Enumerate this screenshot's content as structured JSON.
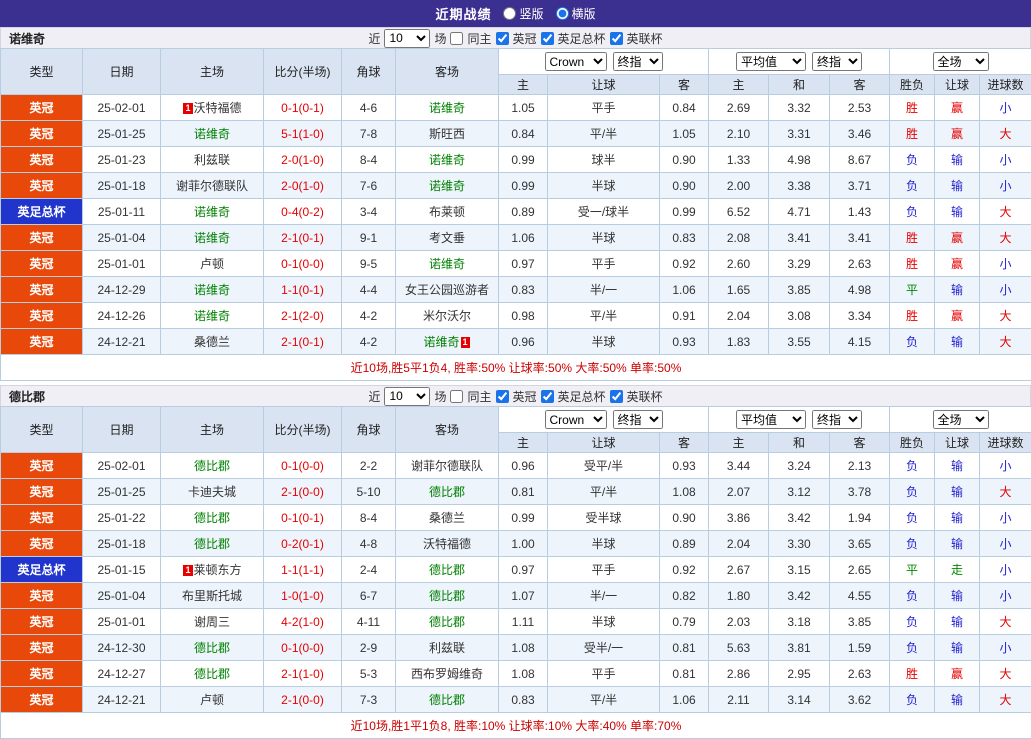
{
  "title_bar": {
    "title": "近期战绩",
    "options": [
      {
        "label": "竖版",
        "selected": false
      },
      {
        "label": "横版",
        "selected": true
      }
    ]
  },
  "colors": {
    "topbar": "#3b2f90",
    "league_championship": "#e8490b",
    "league_fa_cup": "#2135cc",
    "focus_team": "#008000",
    "win": "#e60000",
    "loss": "#2222cc",
    "draw": "#008800",
    "score": "#e60000"
  },
  "sections": [
    {
      "team": "诺维奇",
      "filter": {
        "near_label": "近",
        "count": "10",
        "unit_label": "场",
        "same_home": {
          "label": "同主",
          "checked": false
        },
        "leagues": [
          {
            "label": "英冠",
            "checked": true
          },
          {
            "label": "英足总杯",
            "checked": true
          },
          {
            "label": "英联杯",
            "checked": true
          }
        ]
      },
      "header": {
        "base_cols": [
          "类型",
          "日期",
          "主场",
          "比分(半场)",
          "角球",
          "客场"
        ],
        "bookmaker_select": "Crown",
        "final_select": "终指",
        "average_select": "平均值",
        "final_select2": "终指",
        "scope_select": "全场",
        "sub_cols": [
          "主",
          "让球",
          "客",
          "主",
          "和",
          "客",
          "胜负",
          "让球",
          "进球数"
        ]
      },
      "rows": [
        {
          "type": "英冠",
          "date": "25-02-01",
          "home": {
            "name": "沃特福德",
            "badge": "1",
            "badge_pos": "pre"
          },
          "score": "0-1(0-1)",
          "corner": "4-6",
          "away": {
            "name": "诺维奇",
            "focus": true
          },
          "asia": [
            "1.05",
            "平手",
            "0.84"
          ],
          "euro": [
            "2.69",
            "3.32",
            "2.53"
          ],
          "results": [
            "胜",
            "赢",
            "小"
          ]
        },
        {
          "type": "英冠",
          "date": "25-01-25",
          "home": {
            "name": "诺维奇",
            "focus": true
          },
          "score": "5-1(1-0)",
          "corner": "7-8",
          "away": {
            "name": "斯旺西"
          },
          "asia": [
            "0.84",
            "平/半",
            "1.05"
          ],
          "euro": [
            "2.10",
            "3.31",
            "3.46"
          ],
          "results": [
            "胜",
            "赢",
            "大"
          ]
        },
        {
          "type": "英冠",
          "date": "25-01-23",
          "home": {
            "name": "利兹联"
          },
          "score": "2-0(1-0)",
          "corner": "8-4",
          "away": {
            "name": "诺维奇",
            "focus": true
          },
          "asia": [
            "0.99",
            "球半",
            "0.90"
          ],
          "euro": [
            "1.33",
            "4.98",
            "8.67"
          ],
          "results": [
            "负",
            "输",
            "小"
          ]
        },
        {
          "type": "英冠",
          "date": "25-01-18",
          "home": {
            "name": "谢菲尔德联队"
          },
          "score": "2-0(1-0)",
          "corner": "7-6",
          "away": {
            "name": "诺维奇",
            "focus": true
          },
          "asia": [
            "0.99",
            "半球",
            "0.90"
          ],
          "euro": [
            "2.00",
            "3.38",
            "3.71"
          ],
          "results": [
            "负",
            "输",
            "小"
          ]
        },
        {
          "type": "英足总杯",
          "date": "25-01-11",
          "home": {
            "name": "诺维奇",
            "focus": true
          },
          "score": "0-4(0-2)",
          "corner": "3-4",
          "away": {
            "name": "布莱顿"
          },
          "asia": [
            "0.89",
            "受一/球半",
            "0.99"
          ],
          "euro": [
            "6.52",
            "4.71",
            "1.43"
          ],
          "results": [
            "负",
            "输",
            "大"
          ]
        },
        {
          "type": "英冠",
          "date": "25-01-04",
          "home": {
            "name": "诺维奇",
            "focus": true
          },
          "score": "2-1(0-1)",
          "corner": "9-1",
          "away": {
            "name": "考文垂"
          },
          "asia": [
            "1.06",
            "半球",
            "0.83"
          ],
          "euro": [
            "2.08",
            "3.41",
            "3.41"
          ],
          "results": [
            "胜",
            "赢",
            "大"
          ]
        },
        {
          "type": "英冠",
          "date": "25-01-01",
          "home": {
            "name": "卢顿"
          },
          "score": "0-1(0-0)",
          "corner": "9-5",
          "away": {
            "name": "诺维奇",
            "focus": true
          },
          "asia": [
            "0.97",
            "平手",
            "0.92"
          ],
          "euro": [
            "2.60",
            "3.29",
            "2.63"
          ],
          "results": [
            "胜",
            "赢",
            "小"
          ]
        },
        {
          "type": "英冠",
          "date": "24-12-29",
          "home": {
            "name": "诺维奇",
            "focus": true
          },
          "score": "1-1(0-1)",
          "corner": "4-4",
          "away": {
            "name": "女王公园巡游者"
          },
          "asia": [
            "0.83",
            "半/一",
            "1.06"
          ],
          "euro": [
            "1.65",
            "3.85",
            "4.98"
          ],
          "results": [
            "平",
            "输",
            "小"
          ]
        },
        {
          "type": "英冠",
          "date": "24-12-26",
          "home": {
            "name": "诺维奇",
            "focus": true
          },
          "score": "2-1(2-0)",
          "corner": "4-2",
          "away": {
            "name": "米尔沃尔"
          },
          "asia": [
            "0.98",
            "平/半",
            "0.91"
          ],
          "euro": [
            "2.04",
            "3.08",
            "3.34"
          ],
          "results": [
            "胜",
            "赢",
            "大"
          ]
        },
        {
          "type": "英冠",
          "date": "24-12-21",
          "home": {
            "name": "桑德兰"
          },
          "score": "2-1(0-1)",
          "corner": "4-2",
          "away": {
            "name": "诺维奇",
            "focus": true,
            "badge": "1",
            "badge_pos": "post"
          },
          "asia": [
            "0.96",
            "半球",
            "0.93"
          ],
          "euro": [
            "1.83",
            "3.55",
            "4.15"
          ],
          "results": [
            "负",
            "输",
            "大"
          ]
        }
      ],
      "summary": "近10场,胜5平1负4, 胜率:50% 让球率:50% 大率:50% 单率:50%"
    },
    {
      "team": "德比郡",
      "filter": {
        "near_label": "近",
        "count": "10",
        "unit_label": "场",
        "same_home": {
          "label": "同主",
          "checked": false
        },
        "leagues": [
          {
            "label": "英冠",
            "checked": true
          },
          {
            "label": "英足总杯",
            "checked": true
          },
          {
            "label": "英联杯",
            "checked": true
          }
        ]
      },
      "header": {
        "base_cols": [
          "类型",
          "日期",
          "主场",
          "比分(半场)",
          "角球",
          "客场"
        ],
        "bookmaker_select": "Crown",
        "final_select": "终指",
        "average_select": "平均值",
        "final_select2": "终指",
        "scope_select": "全场",
        "sub_cols": [
          "主",
          "让球",
          "客",
          "主",
          "和",
          "客",
          "胜负",
          "让球",
          "进球数"
        ]
      },
      "rows": [
        {
          "type": "英冠",
          "date": "25-02-01",
          "home": {
            "name": "德比郡",
            "focus": true
          },
          "score": "0-1(0-0)",
          "corner": "2-2",
          "away": {
            "name": "谢菲尔德联队"
          },
          "asia": [
            "0.96",
            "受平/半",
            "0.93"
          ],
          "euro": [
            "3.44",
            "3.24",
            "2.13"
          ],
          "results": [
            "负",
            "输",
            "小"
          ]
        },
        {
          "type": "英冠",
          "date": "25-01-25",
          "home": {
            "name": "卡迪夫城"
          },
          "score": "2-1(0-0)",
          "corner": "5-10",
          "away": {
            "name": "德比郡",
            "focus": true
          },
          "asia": [
            "0.81",
            "平/半",
            "1.08"
          ],
          "euro": [
            "2.07",
            "3.12",
            "3.78"
          ],
          "results": [
            "负",
            "输",
            "大"
          ]
        },
        {
          "type": "英冠",
          "date": "25-01-22",
          "home": {
            "name": "德比郡",
            "focus": true
          },
          "score": "0-1(0-1)",
          "corner": "8-4",
          "away": {
            "name": "桑德兰"
          },
          "asia": [
            "0.99",
            "受半球",
            "0.90"
          ],
          "euro": [
            "3.86",
            "3.42",
            "1.94"
          ],
          "results": [
            "负",
            "输",
            "小"
          ]
        },
        {
          "type": "英冠",
          "date": "25-01-18",
          "home": {
            "name": "德比郡",
            "focus": true
          },
          "score": "0-2(0-1)",
          "corner": "4-8",
          "away": {
            "name": "沃特福德"
          },
          "asia": [
            "1.00",
            "半球",
            "0.89"
          ],
          "euro": [
            "2.04",
            "3.30",
            "3.65"
          ],
          "results": [
            "负",
            "输",
            "小"
          ]
        },
        {
          "type": "英足总杯",
          "date": "25-01-15",
          "home": {
            "name": "莱顿东方",
            "badge": "1",
            "badge_pos": "pre"
          },
          "score": "1-1(1-1)",
          "corner": "2-4",
          "away": {
            "name": "德比郡",
            "focus": true
          },
          "asia": [
            "0.97",
            "平手",
            "0.92"
          ],
          "euro": [
            "2.67",
            "3.15",
            "2.65"
          ],
          "results": [
            "平",
            "走",
            "小"
          ]
        },
        {
          "type": "英冠",
          "date": "25-01-04",
          "home": {
            "name": "布里斯托城"
          },
          "score": "1-0(1-0)",
          "corner": "6-7",
          "away": {
            "name": "德比郡",
            "focus": true
          },
          "asia": [
            "1.07",
            "半/一",
            "0.82"
          ],
          "euro": [
            "1.80",
            "3.42",
            "4.55"
          ],
          "results": [
            "负",
            "输",
            "小"
          ]
        },
        {
          "type": "英冠",
          "date": "25-01-01",
          "home": {
            "name": "谢周三"
          },
          "score": "4-2(1-0)",
          "corner": "4-11",
          "away": {
            "name": "德比郡",
            "focus": true
          },
          "asia": [
            "1.11",
            "半球",
            "0.79"
          ],
          "euro": [
            "2.03",
            "3.18",
            "3.85"
          ],
          "results": [
            "负",
            "输",
            "大"
          ]
        },
        {
          "type": "英冠",
          "date": "24-12-30",
          "home": {
            "name": "德比郡",
            "focus": true
          },
          "score": "0-1(0-0)",
          "corner": "2-9",
          "away": {
            "name": "利兹联"
          },
          "asia": [
            "1.08",
            "受半/一",
            "0.81"
          ],
          "euro": [
            "5.63",
            "3.81",
            "1.59"
          ],
          "results": [
            "负",
            "输",
            "小"
          ]
        },
        {
          "type": "英冠",
          "date": "24-12-27",
          "home": {
            "name": "德比郡",
            "focus": true
          },
          "score": "2-1(1-0)",
          "corner": "5-3",
          "away": {
            "name": "西布罗姆维奇"
          },
          "asia": [
            "1.08",
            "平手",
            "0.81"
          ],
          "euro": [
            "2.86",
            "2.95",
            "2.63"
          ],
          "results": [
            "胜",
            "赢",
            "大"
          ]
        },
        {
          "type": "英冠",
          "date": "24-12-21",
          "home": {
            "name": "卢顿"
          },
          "score": "2-1(0-0)",
          "corner": "7-3",
          "away": {
            "name": "德比郡",
            "focus": true
          },
          "asia": [
            "0.83",
            "平/半",
            "1.06"
          ],
          "euro": [
            "2.11",
            "3.14",
            "3.62"
          ],
          "results": [
            "负",
            "输",
            "大"
          ]
        }
      ],
      "summary": "近10场,胜1平1负8, 胜率:10% 让球率:10% 大率:40% 单率:70%"
    }
  ]
}
